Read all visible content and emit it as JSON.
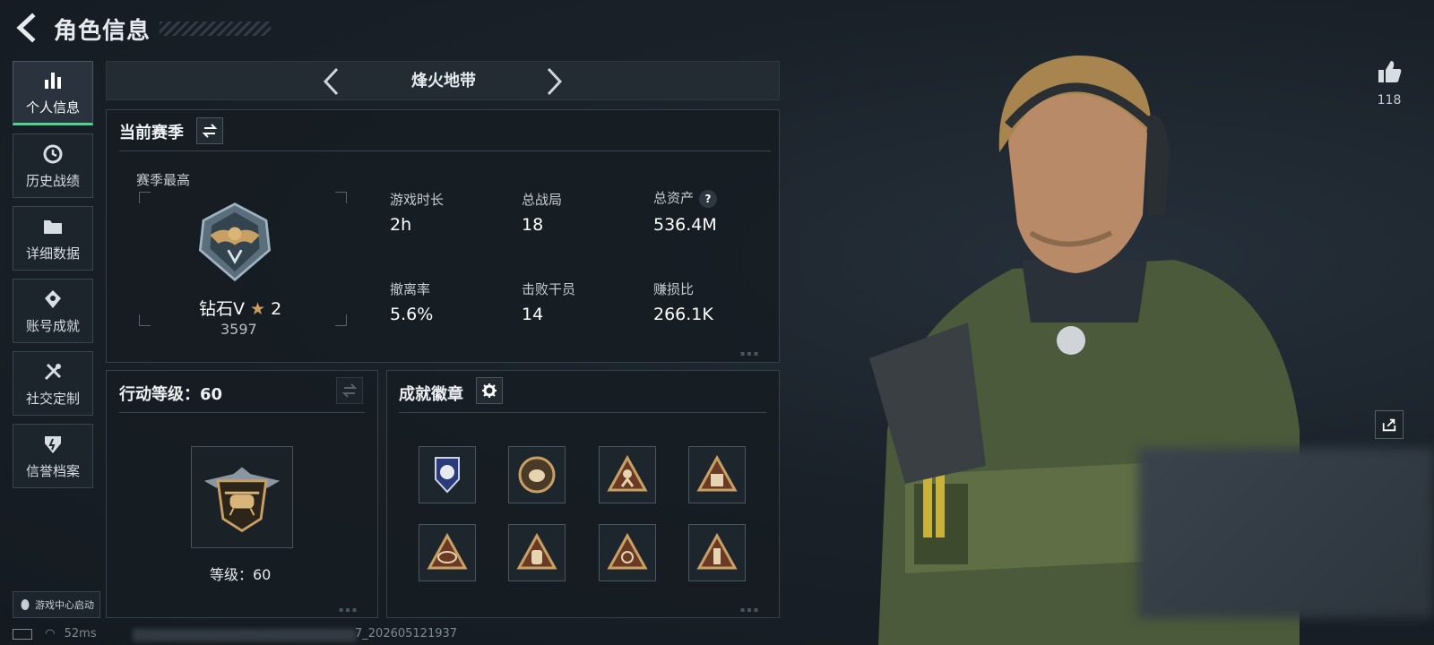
{
  "header": {
    "title": "角色信息"
  },
  "sidebar": {
    "items": [
      {
        "label": "个人信息",
        "icon": "bar-chart-icon",
        "active": true
      },
      {
        "label": "历史战绩",
        "icon": "history-icon",
        "active": false
      },
      {
        "label": "详细数据",
        "icon": "folder-icon",
        "active": false
      },
      {
        "label": "账号成就",
        "icon": "achievement-icon",
        "active": false
      },
      {
        "label": "社交定制",
        "icon": "tools-icon",
        "active": false
      },
      {
        "label": "信誉档案",
        "icon": "credit-icon",
        "active": false
      }
    ],
    "game_center": "游戏中心启动"
  },
  "mode": {
    "name": "烽火地带"
  },
  "season": {
    "title": "当前赛季",
    "best_label": "赛季最高",
    "rank_name": "钻石V",
    "rank_stars": "2",
    "rank_points": "3597",
    "stats": [
      {
        "label": "游戏时长",
        "value": "2h"
      },
      {
        "label": "总战局",
        "value": "18"
      },
      {
        "label": "总资产",
        "value": "536.4M",
        "help": "?"
      },
      {
        "label": "撤离率",
        "value": "5.6%"
      },
      {
        "label": "击败干员",
        "value": "14"
      },
      {
        "label": "赚损比",
        "value": "266.1K"
      }
    ]
  },
  "action_level": {
    "title": "行动等级：60",
    "level_text": "等级：60"
  },
  "badges": {
    "title": "成就徽章",
    "items": [
      "shield-badge-icon",
      "seal-badge-icon",
      "soldier-badge-icon",
      "crate-badge-icon",
      "sk-badge-icon",
      "backpack-badge-icon",
      "sg-badge-icon",
      "supply-badge-icon"
    ]
  },
  "right": {
    "like_count": "118"
  },
  "status": {
    "ping": "52ms",
    "build": "7_202605121937"
  },
  "colors": {
    "accent": "#4fd38d",
    "gold": "#c9a063",
    "panel": "#161c22"
  }
}
